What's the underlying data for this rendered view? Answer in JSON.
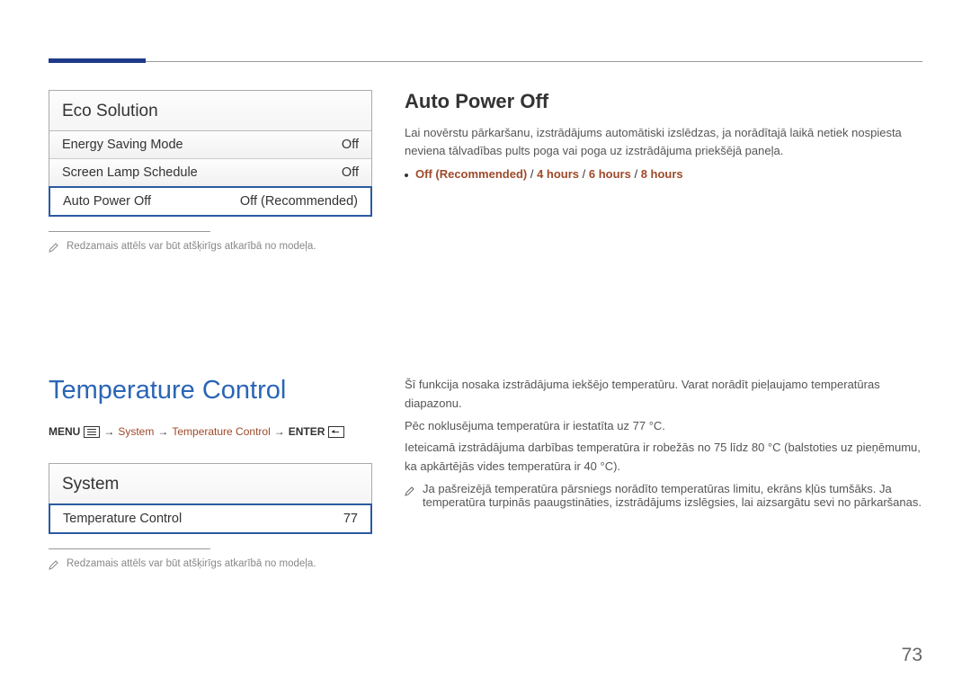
{
  "eco_card": {
    "title": "Eco Solution",
    "rows": [
      {
        "label": "Energy Saving Mode",
        "value": "Off"
      },
      {
        "label": "Screen Lamp Schedule",
        "value": "Off"
      },
      {
        "label": "Auto Power Off",
        "value": "Off (Recommended)"
      }
    ]
  },
  "note1": "Redzamais attēls var būt atšķirīgs atkarībā no modeļa.",
  "auto_power": {
    "title": "Auto Power Off",
    "desc": "Lai novērstu pārkaršanu, izstrādājums automātiski izslēdzas, ja norādītajā laikā netiek nospiesta neviena tālvadības pults poga vai poga uz izstrādājuma priekšējā paneļa.",
    "opt_off": "Off (Recommended)",
    "opt_4h": "4 hours",
    "opt_6h": "6 hours",
    "opt_8h": "8 hours",
    "slash": " / "
  },
  "temp": {
    "title": "Temperature Control",
    "crumb_menu": "MENU",
    "crumb_system": "System",
    "crumb_tc": "Temperature Control",
    "crumb_enter": "ENTER",
    "crumb_arrow": "→"
  },
  "system_card": {
    "title": "System",
    "row_label": "Temperature Control",
    "row_value": "77"
  },
  "note2": "Redzamais attēls var būt atšķirīgs atkarībā no modeļa.",
  "temp_paras": {
    "p1": "Šī funkcija nosaka izstrādājuma iekšējo temperatūru. Varat norādīt pieļaujamo temperatūras diapazonu.",
    "p2": "Pēc noklusējuma temperatūra ir iestatīta uz 77 °C.",
    "p3": "Ieteicamā izstrādājuma darbības temperatūra ir robežās no 75 līdz 80 °C (balstoties uz pieņēmumu, ka apkārtējās vides temperatūra ir 40 °C).",
    "note": "Ja pašreizējā temperatūra pārsniegs norādīto temperatūras limitu, ekrāns kļūs tumšāks. Ja temperatūra turpinās paaugstināties, izstrādājums izslēgsies, lai aizsargātu sevi no pārkaršanas."
  },
  "page_number": "73"
}
